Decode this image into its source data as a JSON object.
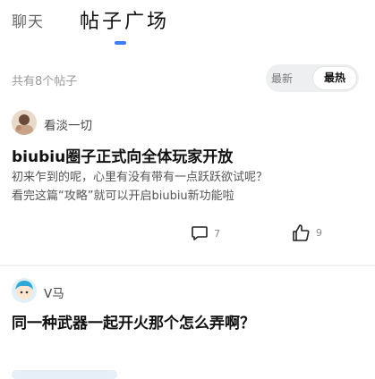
{
  "tabs": {
    "chat": "聊天",
    "plaza": "帖子广场"
  },
  "post_count": "共有8个帖子",
  "sort": {
    "newest": "最新",
    "hottest": "最热",
    "selected": "最热"
  },
  "posts": [
    {
      "author": "看淡一切",
      "title": "biubiu圈子正式向全体玩家开放",
      "body_line1": "初来乍到的呢，心里有没有带有一点跃跃欲试呢？",
      "body_line2": "看完这篇“攻略”就可以开启biubiu新功能啦",
      "comments": "7",
      "likes": "9"
    },
    {
      "author": "V马",
      "title": "同一种武器一起开火那个怎么弄啊？"
    }
  ],
  "colors": {
    "accent": "#3d7bf2",
    "text": "#111111",
    "muted": "#9a9a9a"
  }
}
